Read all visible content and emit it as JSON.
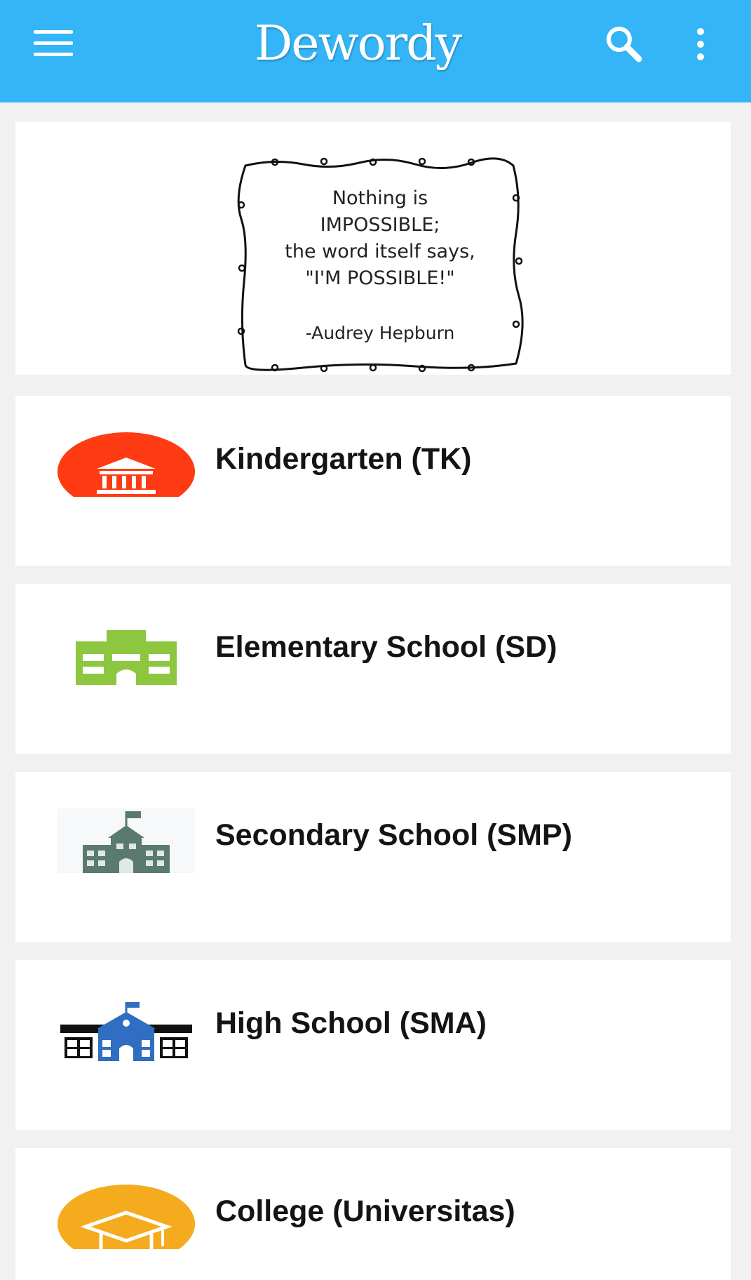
{
  "app": {
    "title": "Dewordy",
    "accent_color": "#33b5f7"
  },
  "toolbar": {
    "menu_icon": "hamburger-menu-icon",
    "search_icon": "search-icon",
    "more_icon": "more-vert-icon"
  },
  "banner": {
    "quote_lines": [
      "Nothing is",
      "IMPOSSIBLE;",
      "the word itself says,",
      "\"I'M POSSIBLE!\""
    ],
    "author": "-Audrey Hepburn"
  },
  "categories": [
    {
      "label": "Kindergarten (TK)",
      "icon": "museum-building-icon",
      "color": "#fe3b12"
    },
    {
      "label": "Elementary School (SD)",
      "icon": "school-building-icon",
      "color": "#8dc63f"
    },
    {
      "label": "Secondary School (SMP)",
      "icon": "school-flag-building-icon",
      "color": "#5a7a70"
    },
    {
      "label": "High School (SMA)",
      "icon": "high-school-building-icon",
      "color": "#2f6ec0"
    },
    {
      "label": "College (Universitas)",
      "icon": "graduation-cap-icon",
      "color": "#f5ab1e"
    }
  ]
}
